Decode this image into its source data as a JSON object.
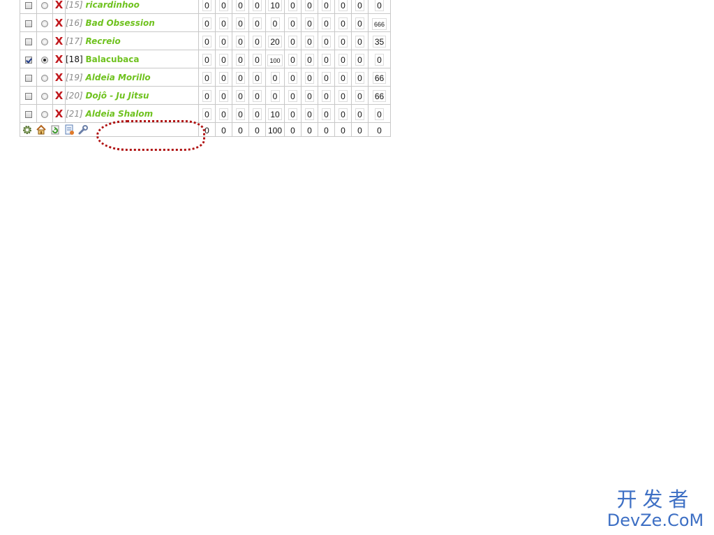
{
  "rows": [
    {
      "checked": false,
      "selected": false,
      "index": "[15]",
      "name": "ricardinhoo",
      "values": [
        "0",
        "0",
        "0",
        "0",
        "10",
        "0",
        "0",
        "0",
        "0",
        "0",
        "0"
      ]
    },
    {
      "checked": false,
      "selected": false,
      "index": "[16]",
      "name": "Bad Obsession",
      "values": [
        "0",
        "0",
        "0",
        "0",
        "0",
        "0",
        "0",
        "0",
        "0",
        "0",
        "666"
      ]
    },
    {
      "checked": false,
      "selected": false,
      "index": "[17]",
      "name": "Recreio",
      "values": [
        "0",
        "0",
        "0",
        "0",
        "20",
        "0",
        "0",
        "0",
        "0",
        "0",
        "35"
      ]
    },
    {
      "checked": true,
      "selected": true,
      "index": "[18]",
      "name": "Balacubaca",
      "values": [
        "0",
        "0",
        "0",
        "0",
        "100",
        "0",
        "0",
        "0",
        "0",
        "0",
        "0"
      ]
    },
    {
      "checked": false,
      "selected": false,
      "index": "[19]",
      "name": "Aldeia Morillo",
      "values": [
        "0",
        "0",
        "0",
        "0",
        "0",
        "0",
        "0",
        "0",
        "0",
        "0",
        "66"
      ]
    },
    {
      "checked": false,
      "selected": false,
      "index": "[20]",
      "name": "Dojô - Ju Jitsu",
      "values": [
        "0",
        "0",
        "0",
        "0",
        "0",
        "0",
        "0",
        "0",
        "0",
        "0",
        "66"
      ]
    },
    {
      "checked": false,
      "selected": false,
      "index": "[21]",
      "name": "Aldeia Shalom",
      "values": [
        "0",
        "0",
        "0",
        "0",
        "10",
        "0",
        "0",
        "0",
        "0",
        "0",
        "0"
      ]
    }
  ],
  "totals": [
    "0",
    "0",
    "0",
    "0",
    "100",
    "0",
    "0",
    "0",
    "0",
    "0",
    "0"
  ],
  "toolbar": {
    "icons": [
      "gear-icon",
      "home-icon",
      "refresh-icon",
      "document-icon",
      "wrench-icon"
    ]
  },
  "colors": {
    "name_link": "#6fc21f",
    "delete_icon": "#c0171c",
    "annotation": "#b01212",
    "watermark": "#3d6fc4"
  },
  "delete_glyph": "X",
  "watermark": {
    "cn": "开发者",
    "en": "DevZe.CoM"
  }
}
